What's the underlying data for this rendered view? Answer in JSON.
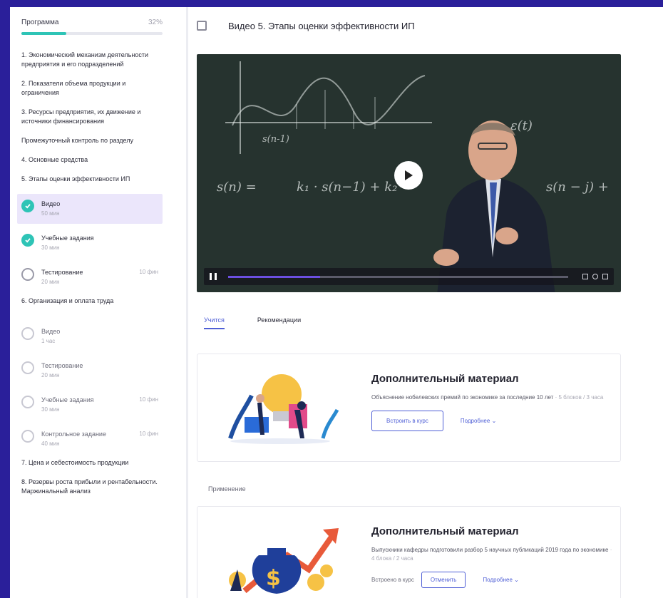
{
  "sidebar": {
    "progress_label": "Программа",
    "progress_pct": "32%",
    "progress_value": 0.32,
    "sections": [
      "1. Экономический механизм деятельности предприятия и его подразделений",
      "2. Показатели объема продукции и ограничения",
      "3. Ресурсы предприятия, их движение и источники финансирования",
      "Промежуточный контроль по разделу",
      "4. Основные средства",
      "5. Этапы оценки эффективности ИП"
    ],
    "items_5": [
      {
        "title": "Видео",
        "sub": "50 мин",
        "tag": "",
        "state": "done"
      },
      {
        "title": "Учебные задания",
        "sub": "30 мин",
        "tag": "",
        "state": "done"
      },
      {
        "title": "Тестирование",
        "sub": "20 мин",
        "tag": "10 фин",
        "state": "ring"
      }
    ],
    "section_6": "6. Организация и оплата труда",
    "items_6": [
      {
        "title": "Видео",
        "sub": "1 час",
        "tag": ""
      },
      {
        "title": "Тестирование",
        "sub": "20 мин",
        "tag": ""
      },
      {
        "title": "Учебные задания",
        "sub": "30 мин",
        "tag": "10 фин"
      },
      {
        "title": "Контрольное задание",
        "sub": "40 мин",
        "tag": "10 фин"
      }
    ],
    "section_7": "7. Цена и себестоимость продукции",
    "section_8": "8. Резервы роста прибыли и рентабельности. Маржинальный анализ"
  },
  "main": {
    "title": "Видео 5. Этапы оценки эффективности ИП",
    "video": {
      "progress": 0.27,
      "chalk": [
        "s(n-1)",
        "s(n) =",
        "k₁ · s(n−1) + k₂",
        "s(n − j) +",
        "ε(t)"
      ]
    },
    "tabs": [
      "Учится",
      "Рекомендации"
    ],
    "cards": [
      {
        "title": "Дополнительный материал",
        "desc": "Объяснение нобелевских премий по экономике за последние 10 лет",
        "meta": "· 5 блоков / 3 часа",
        "primary": "Встроить в курс",
        "more": "Подробнее"
      },
      {
        "title": "Дополнительный материал",
        "desc": "Выпускники кафедры подготовили разбор 5 научных публикаций 2019 года по экономике",
        "meta": "· 4 блока / 2 часа",
        "status": "Встроено в курс",
        "primary": "Отменить",
        "more": "Подробнее"
      }
    ],
    "section_label": "Применение"
  },
  "colors": {
    "accent": "#4f5fd6",
    "teal": "#2ec4b6",
    "frame": "#2a1f9a",
    "active_bg": "#ebe6fb"
  }
}
